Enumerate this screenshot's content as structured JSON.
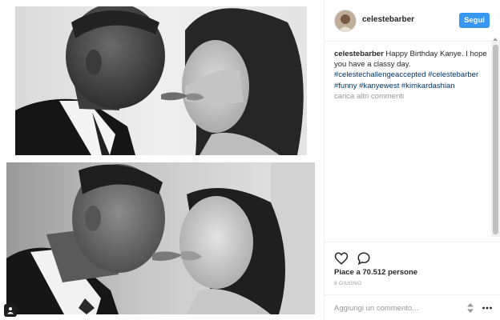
{
  "post": {
    "username": "celestebarber",
    "follow_label": "Segui"
  },
  "caption": {
    "username": "celestebarber",
    "text": " Happy Birthday Kanye. I hope you have a classy day. ",
    "hashtags": [
      "#celestechallengeaccepted",
      "#celestebarber",
      "#funny",
      "#kanyewest",
      "#kimkardashian"
    ]
  },
  "load_more_comments": "carica altri commenti",
  "likes": "Piace a 70.512 persone",
  "date": "8 GIUGNO",
  "comment_box": {
    "placeholder": "Aggiungi un commento..."
  },
  "icons": {
    "like": "heart-icon",
    "comment": "comment-bubble-icon",
    "more": "more-options-icon",
    "user_tag": "user-tag-icon",
    "scroll": "updown-arrows-icon"
  },
  "colors": {
    "follow_button": "#3897f0",
    "hashtag": "#003569",
    "muted_text": "#999999",
    "text": "#262626"
  }
}
